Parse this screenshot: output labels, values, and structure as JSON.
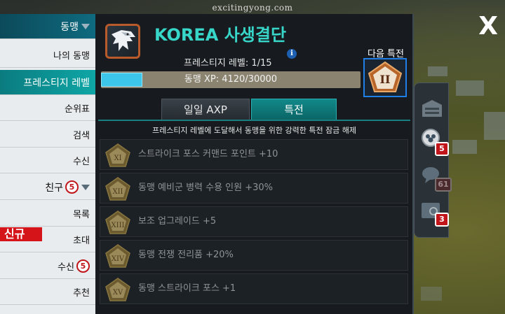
{
  "watermark": "excitingyong.com",
  "close_label": "X",
  "sidebar": {
    "alliance_header": "동맹",
    "items": [
      {
        "label": "나의 동맹"
      },
      {
        "label": "프레스티지 레벨"
      },
      {
        "label": "순위표"
      },
      {
        "label": "검색"
      },
      {
        "label": "수신"
      }
    ],
    "friends_header": "친구",
    "friends_count": "5",
    "friend_items": [
      {
        "label": "목록"
      },
      {
        "label": "초대"
      },
      {
        "label": "수신",
        "count": "5"
      },
      {
        "label": "추천"
      }
    ],
    "new_badge": "신규"
  },
  "header": {
    "alliance_name": "KOREA 사생결단",
    "prestige_label": "프레스티지 레벨: 1/15",
    "info_icon_glyph": "i",
    "xp_text": "동맹 XP: 4120/30000",
    "xp_fraction": 0.1373,
    "next_perk_label": "다음 특전",
    "next_perk_numeral": "II"
  },
  "tabs": [
    {
      "label": "일일 AXP",
      "active": false
    },
    {
      "label": "특전",
      "active": true
    }
  ],
  "description": "프레스티지 레벨에 도달해서 동맹을 위한 강력한 특전 잠금 해제",
  "perks": [
    {
      "numeral": "XI",
      "text": "스트라이크 포스 커맨드 포인트 +10"
    },
    {
      "numeral": "XII",
      "text": "동맹 예비군 병력 수용 인원 +30%"
    },
    {
      "numeral": "XIII",
      "text": "보조 업그레이드 +5"
    },
    {
      "numeral": "XIV",
      "text": "동맹 전쟁 전리품 +20%"
    },
    {
      "numeral": "XV",
      "text": "동맹 스트라이크 포스 +1"
    }
  ],
  "right_nav": [
    {
      "icon": "base-icon",
      "count": null
    },
    {
      "icon": "alliance-icon",
      "count": "5"
    },
    {
      "icon": "chat-icon",
      "count": "61"
    },
    {
      "icon": "mail-icon",
      "count": "3"
    }
  ],
  "colors": {
    "accent_teal": "#37d6c8",
    "sidebar_active": "#0fa6a6",
    "badge_red": "#c0161b",
    "xp_fill": "#3bc6ea",
    "emblem_border": "#b85a2a"
  }
}
